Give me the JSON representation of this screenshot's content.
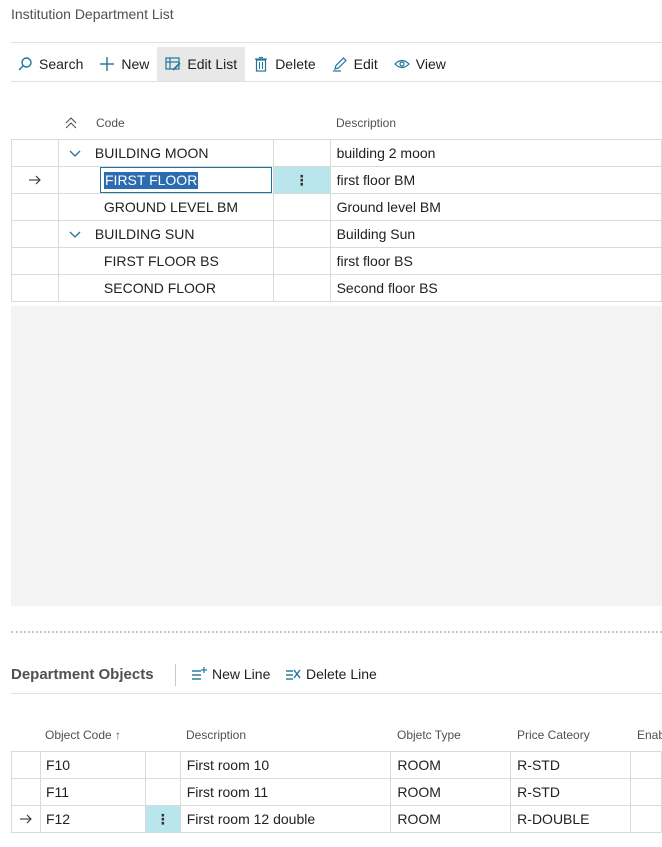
{
  "page": {
    "title": "Institution Department List"
  },
  "toolbar": {
    "search": "Search",
    "new": "New",
    "edit_list": "Edit List",
    "delete": "Delete",
    "edit": "Edit",
    "view": "View"
  },
  "grid": {
    "headers": {
      "code": "Code",
      "description": "Description"
    },
    "rows": [
      {
        "code": "BUILDING MOON",
        "description": "building 2 moon"
      },
      {
        "code": "FIRST FLOOR",
        "description": "first floor BM"
      },
      {
        "code": "GROUND LEVEL BM",
        "description": "Ground level BM"
      },
      {
        "code": "BUILDING SUN",
        "description": "Building Sun"
      },
      {
        "code": "FIRST FLOOR BS",
        "description": "first floor BS"
      },
      {
        "code": "SECOND FLOOR",
        "description": "Second floor BS"
      }
    ]
  },
  "subpage": {
    "title": "Department Objects",
    "new_line": "New Line",
    "delete_line": "Delete Line",
    "headers": {
      "object_code": "Object Code",
      "sort_arrow": "↑",
      "description": "Description",
      "object_type": "Objetc Type",
      "price_category": "Price Cateory",
      "enabled": "Enab"
    },
    "rows": [
      {
        "object_code": "F10",
        "description": "First room 10",
        "object_type": "ROOM",
        "price_category": "R-STD"
      },
      {
        "object_code": "F11",
        "description": "First room 11",
        "object_type": "ROOM",
        "price_category": "R-STD"
      },
      {
        "object_code": "F12",
        "description": "First room 12 double",
        "object_type": "ROOM",
        "price_category": "R-DOUBLE"
      }
    ]
  },
  "colors": {
    "accent": "#20749a",
    "selection": "#b8e6ec",
    "empty_area": "#f3f3f3"
  }
}
